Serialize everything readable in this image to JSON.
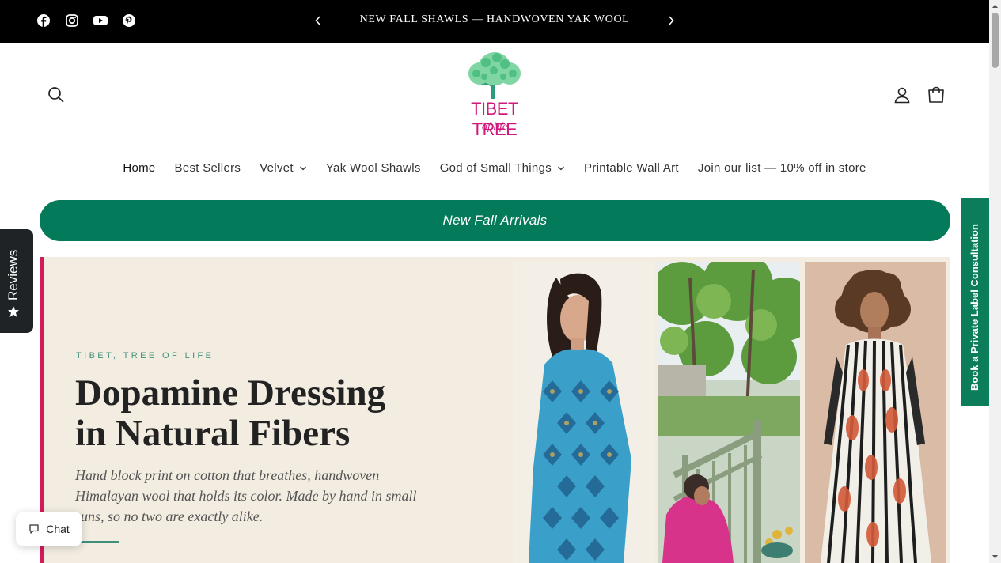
{
  "announcement": {
    "text": "NEW FALL SHAWLS — HANDWOVEN YAK WOOL",
    "social_icons": [
      "facebook-icon",
      "instagram-icon",
      "youtube-icon",
      "pinterest-icon"
    ]
  },
  "header": {
    "logo_line1": "TIBET TREE",
    "logo_line2": "of life"
  },
  "nav": {
    "items": [
      {
        "label": "Home",
        "active": true,
        "dropdown": false
      },
      {
        "label": "Best Sellers",
        "active": false,
        "dropdown": false
      },
      {
        "label": "Velvet",
        "active": false,
        "dropdown": true
      },
      {
        "label": "Yak Wool Shawls",
        "active": false,
        "dropdown": false
      },
      {
        "label": "God of Small Things",
        "active": false,
        "dropdown": true
      },
      {
        "label": "Printable Wall Art",
        "active": false,
        "dropdown": false
      },
      {
        "label": "Join our list — 10% off in store",
        "active": false,
        "dropdown": false
      }
    ]
  },
  "banner": {
    "label": "New Fall Arrivals"
  },
  "hero": {
    "eyebrow": "TIBET, TREE OF LIFE",
    "headline_line1": "Dopamine Dressing",
    "headline_line2": "in Natural Fibers",
    "subcopy": "Hand block print on cotton that breathes, handwoven Himalayan wool that holds its color. Made by hand in small runs, so no two are exactly alike."
  },
  "side_tabs": {
    "reviews": "Reviews",
    "consultation": "Book a Private Label Consultation"
  },
  "chat": {
    "label": "Chat"
  },
  "colors": {
    "announcement_bg": "#000000",
    "brand_green": "#037a5a",
    "brand_pink": "#d0197c",
    "hero_bg": "#f2ece1",
    "accent_teal": "#3f8f7c"
  }
}
